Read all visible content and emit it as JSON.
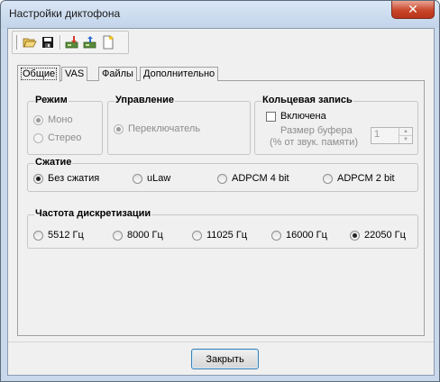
{
  "window": {
    "title": "Настройки диктофона",
    "close_glyph": "✕"
  },
  "toolbar": {
    "icons": [
      "open-folder-icon",
      "save-disk-icon",
      "import-icon",
      "export-icon",
      "new-document-icon"
    ]
  },
  "tabs": [
    {
      "label": "Общие",
      "active": true
    },
    {
      "label": "VAS",
      "active": false
    },
    {
      "label": "Файлы",
      "active": false
    },
    {
      "label": "Дополнительно",
      "active": false
    }
  ],
  "mode": {
    "title": "Режим",
    "options": [
      {
        "label": "Моно",
        "checked": true,
        "disabled": true
      },
      {
        "label": "Стерео",
        "checked": false,
        "disabled": true
      }
    ]
  },
  "control": {
    "title": "Управление",
    "options": [
      {
        "label": "Переключатель",
        "checked": true,
        "disabled": true
      }
    ]
  },
  "ring": {
    "title": "Кольцевая запись",
    "enabled_label": "Включена",
    "enabled": false,
    "buffer_label_1": "Размер буфера",
    "buffer_label_2": "(% от звук. памяти)",
    "buffer_value": "1"
  },
  "compression": {
    "title": "Сжатие",
    "options": [
      {
        "label": "Без сжатия",
        "checked": true
      },
      {
        "label": "uLaw",
        "checked": false
      },
      {
        "label": "ADPCM 4 bit",
        "checked": false
      },
      {
        "label": "ADPCM 2 bit",
        "checked": false
      }
    ]
  },
  "sample_rate": {
    "title": "Частота дискретизации",
    "options": [
      {
        "label": "5512 Гц",
        "checked": false
      },
      {
        "label": "8000 Гц",
        "checked": false
      },
      {
        "label": "11025 Гц",
        "checked": false
      },
      {
        "label": "16000 Гц",
        "checked": false
      },
      {
        "label": "22050 Гц",
        "checked": true
      }
    ]
  },
  "footer": {
    "close_label": "Закрыть"
  }
}
